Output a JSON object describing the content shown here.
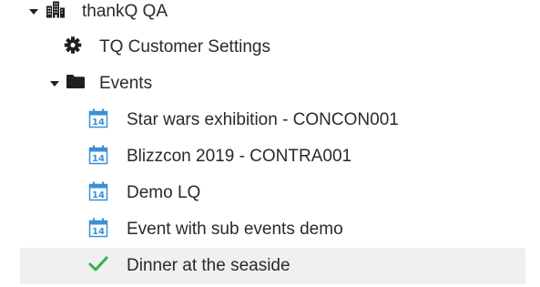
{
  "tree": {
    "root": {
      "label": "thankQ QA",
      "icon": "building-icon",
      "expanded": true,
      "children": {
        "settings": {
          "label": "TQ Customer Settings",
          "icon": "gear-icon"
        },
        "events": {
          "label": "Events",
          "icon": "folder-icon",
          "expanded": true,
          "items": [
            {
              "label": "Star wars exhibition - CONCON001",
              "icon": "calendar-icon",
              "day": "14"
            },
            {
              "label": "Blizzcon 2019 - CONTRA001",
              "icon": "calendar-icon",
              "day": "14"
            },
            {
              "label": "Demo LQ",
              "icon": "calendar-icon",
              "day": "14"
            },
            {
              "label": "Event with sub events demo",
              "icon": "calendar-icon",
              "day": "14"
            },
            {
              "label": "Dinner at the seaside",
              "icon": "checkmark-icon",
              "selected": true
            }
          ]
        }
      }
    }
  },
  "colors": {
    "selected_row": "#f0f0f0",
    "calendar_blue": "#3a8fd6",
    "checkmark_green": "#2db34a",
    "icon_dark": "#1f1f1f"
  }
}
